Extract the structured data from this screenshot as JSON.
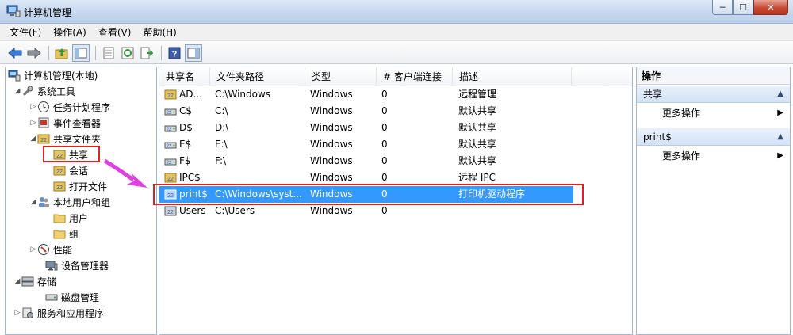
{
  "window": {
    "title": "计算机管理",
    "min_label": "─",
    "max_label": "☐",
    "close_label": "✕"
  },
  "menu": [
    "文件(F)",
    "操作(A)",
    "查看(V)",
    "帮助(H)"
  ],
  "tree": {
    "root": "计算机管理(本地)",
    "system_tools": "系统工具",
    "task_scheduler": "任务计划程序",
    "event_viewer": "事件查看器",
    "shared_folders": "共享文件夹",
    "shares": "共享",
    "sessions": "会话",
    "open_files": "打开文件",
    "local_users_groups": "本地用户和组",
    "users": "用户",
    "groups": "组",
    "performance": "性能",
    "device_manager": "设备管理器",
    "storage": "存储",
    "disk_management": "磁盘管理",
    "services_apps": "服务和应用程序"
  },
  "list": {
    "columns": [
      "共享名",
      "文件夹路径",
      "类型",
      "# 客户端连接",
      "描述"
    ],
    "rows": [
      {
        "name": "AD...",
        "path": "C:\\Windows",
        "type": "Windows",
        "clients": "0",
        "desc": "远程管理"
      },
      {
        "name": "C$",
        "path": "C:\\",
        "type": "Windows",
        "clients": "0",
        "desc": "默认共享"
      },
      {
        "name": "D$",
        "path": "D:\\",
        "type": "Windows",
        "clients": "0",
        "desc": "默认共享"
      },
      {
        "name": "E$",
        "path": "E:\\",
        "type": "Windows",
        "clients": "0",
        "desc": "默认共享"
      },
      {
        "name": "F$",
        "path": "F:\\",
        "type": "Windows",
        "clients": "0",
        "desc": "默认共享"
      },
      {
        "name": "IPC$",
        "path": "",
        "type": "Windows",
        "clients": "0",
        "desc": "远程 IPC"
      },
      {
        "name": "print$",
        "path": "C:\\Windows\\syst...",
        "type": "Windows",
        "clients": "0",
        "desc": "打印机驱动程序"
      },
      {
        "name": "Users",
        "path": "C:\\Users",
        "type": "Windows",
        "clients": "0",
        "desc": ""
      }
    ],
    "selected_index": 6
  },
  "actions": {
    "title": "操作",
    "sections": [
      {
        "label": "共享",
        "item": "更多操作"
      },
      {
        "label": "print$",
        "item": "更多操作"
      }
    ]
  },
  "colors": {
    "selection": "#3399ff",
    "highlight_box": "#e02020",
    "pointer_arrow": "#e040e0"
  }
}
